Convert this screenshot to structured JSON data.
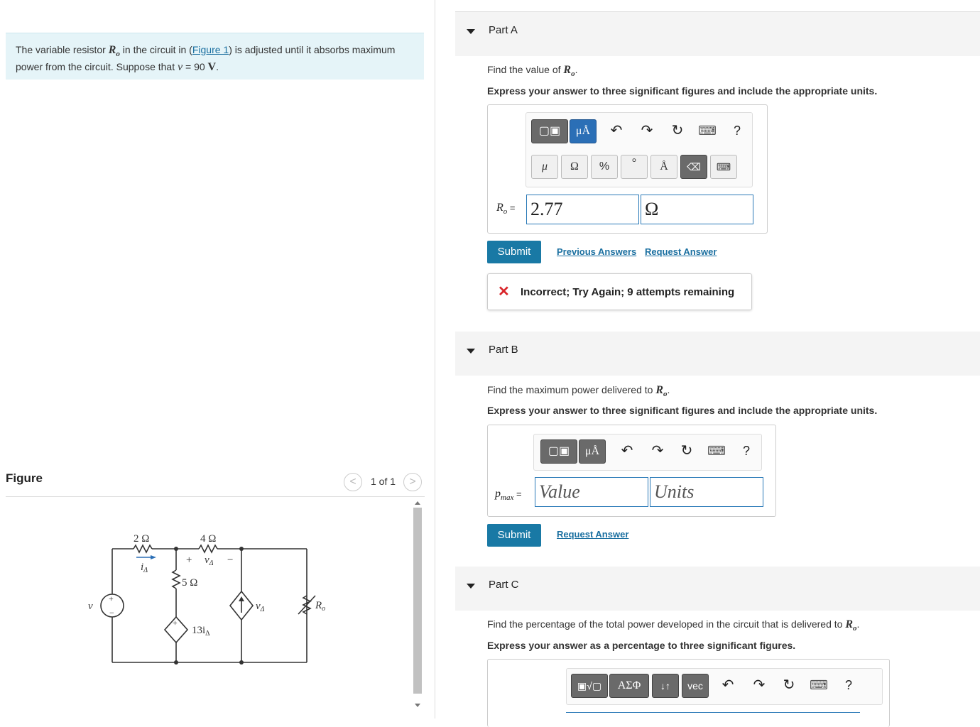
{
  "problem": {
    "text_1": "The variable resistor ",
    "var_ro": "R",
    "var_ro_sub": "o",
    "text_2": " in the circuit in (",
    "figure_link": "Figure 1",
    "text_3": ") is adjusted until it absorbs maximum",
    "text_4": "power from the circuit. Suppose that ",
    "var_v": "v",
    "text_5": " = 90 ",
    "unit_v": "V",
    "text_6": "."
  },
  "figure": {
    "title": "Figure",
    "count": "1 of 1",
    "prev": "<",
    "next": ">",
    "circuit": {
      "r1": "2 Ω",
      "r2": "4 Ω",
      "r3": "5 Ω",
      "i_label": "i",
      "i_sub": "Δ",
      "v_label": "v",
      "v_sub": "Δ",
      "plus": "+",
      "minus": "−",
      "source_v": "v",
      "dep_v": "13i",
      "dep_v_sub": "Δ",
      "cur_src": "v",
      "cur_src_sub": "Δ",
      "ro": "R",
      "ro_sub": "o"
    }
  },
  "partA": {
    "label": "Part A",
    "question_pre": "Find the value of ",
    "question_var": "R",
    "question_sub": "o",
    "question_post": ".",
    "instructions": "Express your answer to three significant figures and include the appropriate units.",
    "toolbar": {
      "templates": "▢▣",
      "units": "μÅ",
      "undo": "↶",
      "redo": "↷",
      "reset": "↻",
      "keyboard": "⌨",
      "help": "?",
      "mu": "μ",
      "omega": "Ω",
      "percent": "%",
      "degree": "°",
      "angstrom": "Å",
      "delete": "⌫",
      "kbd2": "⌨"
    },
    "var_label": "R",
    "var_sub": "o",
    "equals": " =",
    "value": "2.77",
    "unit": "Ω",
    "submit": "Submit",
    "prev_answers": "Previous Answers",
    "request_answer": "Request Answer",
    "feedback_icon": "✕",
    "feedback": "Incorrect; Try Again; 9 attempts remaining"
  },
  "partB": {
    "label": "Part B",
    "question_pre": "Find the maximum power delivered to ",
    "question_var": "R",
    "question_sub": "o",
    "question_post": ".",
    "instructions": "Express your answer to three significant figures and include the appropriate units.",
    "var_label": "p",
    "var_sub": "max",
    "equals": " =",
    "value_placeholder": "Value",
    "units_placeholder": "Units",
    "submit": "Submit",
    "request_answer": "Request Answer"
  },
  "partC": {
    "label": "Part C",
    "question_pre": "Find the percentage of the total power developed in the circuit that is delivered to ",
    "question_var": "R",
    "question_sub": "o",
    "question_post": ".",
    "instructions": "Express your answer as a percentage to three significant figures.",
    "toolbar": {
      "templates": "▣√▢",
      "greek": "ΑΣΦ",
      "arrows": "↓↑",
      "vec": "vec"
    }
  },
  "colors": {
    "problem_bg": "#e5f4f8",
    "submit_bg": "#1979a5",
    "link": "#1a6fa0",
    "error": "#d9252a",
    "field_border": "#2b7ab8"
  }
}
